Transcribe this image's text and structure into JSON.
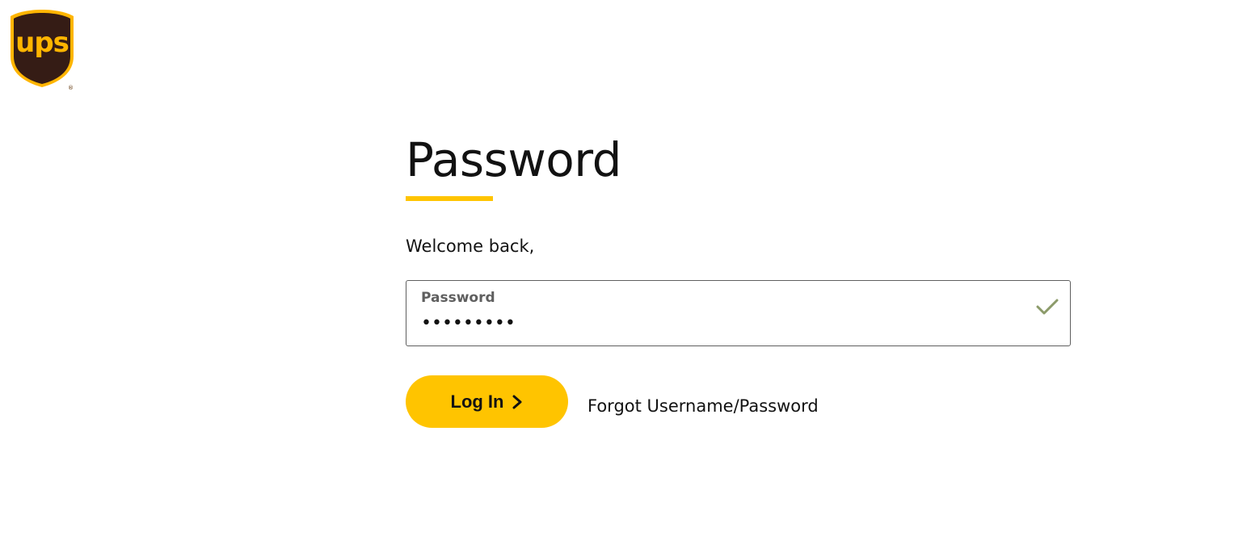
{
  "brand": {
    "logo_text": "ups",
    "registered_mark": "®",
    "colors": {
      "shield_brown": "#351c15",
      "shield_gold": "#ffb500",
      "accent_yellow": "#ffc400",
      "check_green": "#8c9b6a"
    }
  },
  "main": {
    "title": "Password",
    "welcome": "Welcome back,",
    "password_field": {
      "label": "Password",
      "value": "•••••••••",
      "status_icon": "checkmark-icon"
    },
    "login_button": {
      "label": "Log In",
      "icon": "chevron-right-icon"
    },
    "forgot_link": "Forgot Username/Password"
  }
}
